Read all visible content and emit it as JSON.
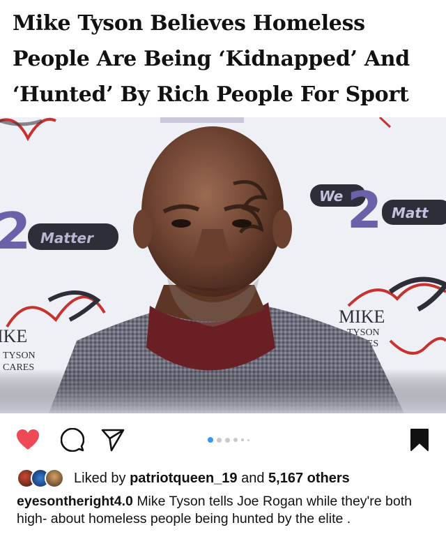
{
  "headline": {
    "lines": [
      "Mike Tyson Believes Homeless",
      "People Are Being ‘Kidnapped’ And",
      "‘Hunted’ By Rich People For Sport"
    ]
  },
  "photo": {
    "backdrop_texts": [
      "We",
      "2",
      "Matter",
      "Matt",
      "MIKE",
      "TYSON",
      "CARES",
      "IKE"
    ],
    "colors": {
      "backdrop": "#eef0f6",
      "purple": "#6b61a8",
      "red": "#c8322e",
      "jacket": "#6e6e7c",
      "turtleneck": "#6a1f25"
    }
  },
  "actions": {
    "icons": [
      "heart-icon",
      "comment-icon",
      "share-icon",
      "bookmark-icon"
    ],
    "carousel_dots": 6,
    "active_dot": 0,
    "colors": {
      "heart": "#ed4956",
      "dot_active": "#3897f0"
    }
  },
  "likes": {
    "prefix": "Liked by",
    "user": "patriotqueen_19",
    "middle": "and",
    "count": "5,167 others"
  },
  "caption": {
    "username": "eyesontheright4.0",
    "text": "Mike Tyson tells Joe Rogan while they're both high- about homeless people being hunted by the elite ."
  }
}
